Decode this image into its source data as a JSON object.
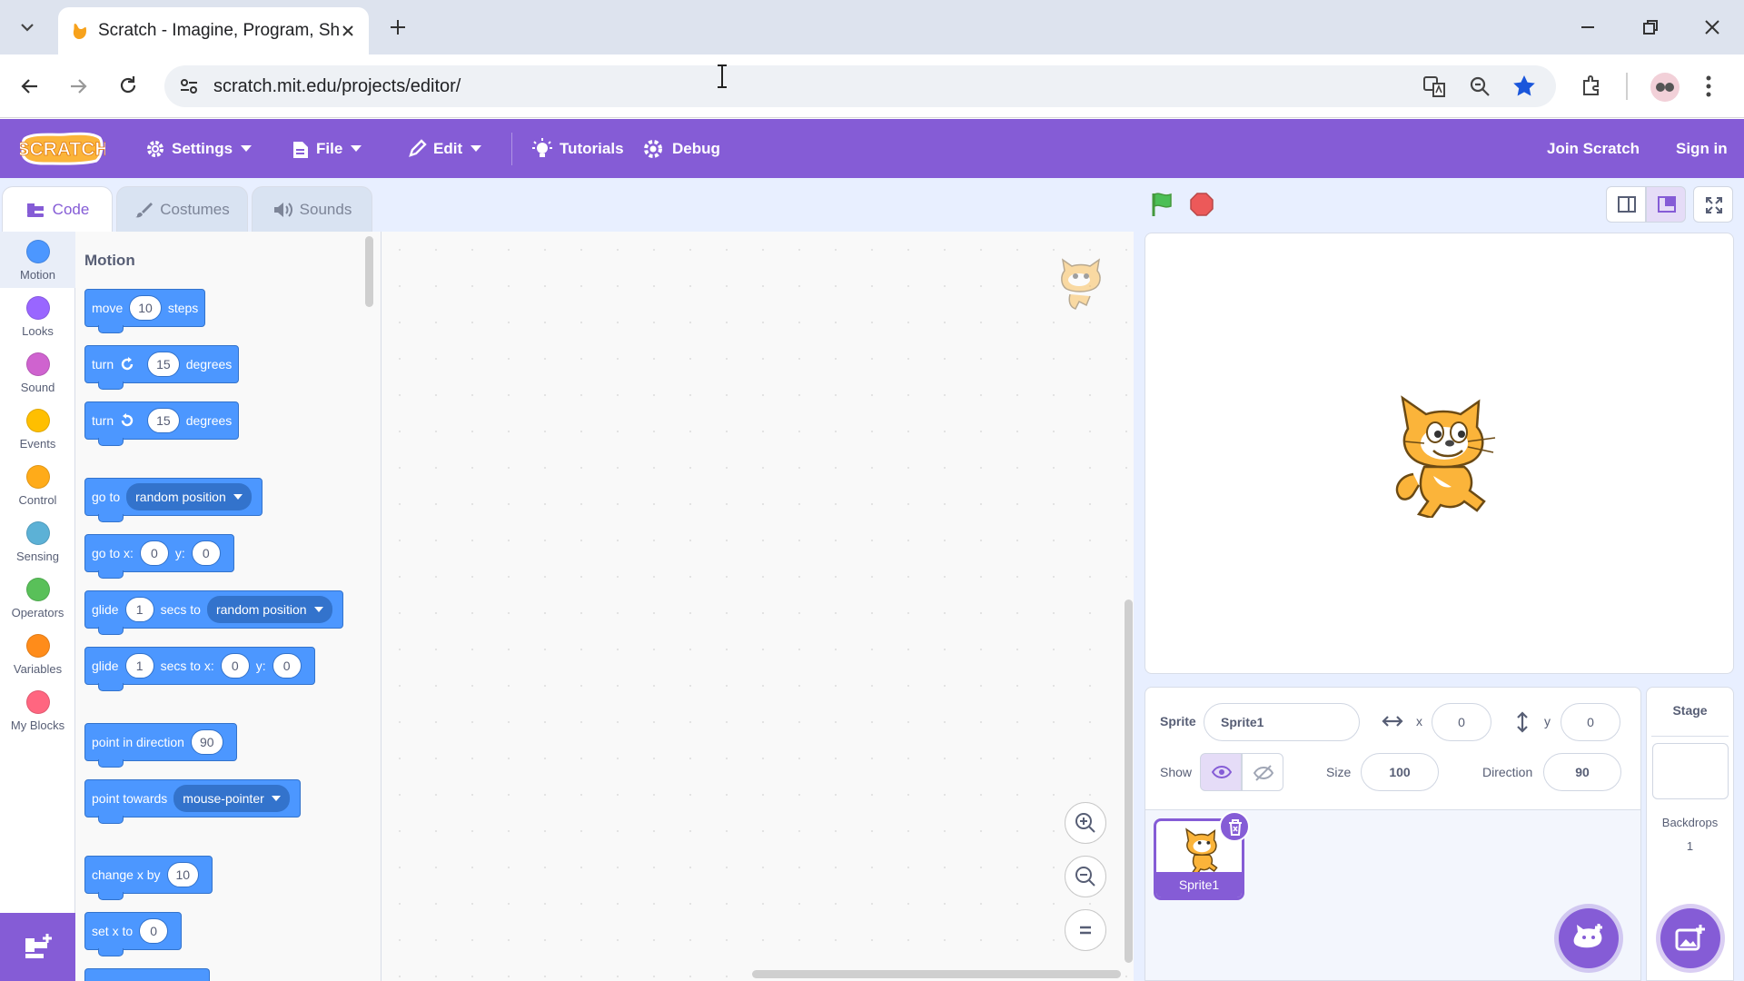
{
  "browser": {
    "tab_title": "Scratch - Imagine, Program, Share",
    "url": "scratch.mit.edu/projects/editor/"
  },
  "menu": {
    "settings": "Settings",
    "file": "File",
    "edit": "Edit",
    "tutorials": "Tutorials",
    "debug": "Debug",
    "join": "Join Scratch",
    "signin": "Sign in"
  },
  "editor_tabs": {
    "code": "Code",
    "costumes": "Costumes",
    "sounds": "Sounds"
  },
  "categories": [
    {
      "label": "Motion",
      "color": "#4c97ff"
    },
    {
      "label": "Looks",
      "color": "#9966ff"
    },
    {
      "label": "Sound",
      "color": "#cf63cf"
    },
    {
      "label": "Events",
      "color": "#ffbf00"
    },
    {
      "label": "Control",
      "color": "#ffab19"
    },
    {
      "label": "Sensing",
      "color": "#5cb1d6"
    },
    {
      "label": "Operators",
      "color": "#59c059"
    },
    {
      "label": "Variables",
      "color": "#ff8c1a"
    },
    {
      "label": "My Blocks",
      "color": "#ff6680"
    }
  ],
  "palette": {
    "heading": "Motion",
    "move": {
      "a": "move",
      "v": "10",
      "b": "steps"
    },
    "turn_right": {
      "a": "turn",
      "v": "15",
      "b": "degrees"
    },
    "turn_left": {
      "a": "turn",
      "v": "15",
      "b": "degrees"
    },
    "goto": {
      "a": "go to",
      "dd": "random position"
    },
    "gotoxy": {
      "a": "go to x:",
      "x": "0",
      "b": "y:",
      "y": "0"
    },
    "glide_to": {
      "a": "glide",
      "v": "1",
      "b": "secs to",
      "dd": "random position"
    },
    "glide_xy": {
      "a": "glide",
      "v": "1",
      "b": "secs to x:",
      "x": "0",
      "c": "y:",
      "y": "0"
    },
    "point_dir": {
      "a": "point in direction",
      "v": "90"
    },
    "point_towards": {
      "a": "point towards",
      "dd": "mouse-pointer"
    },
    "change_x": {
      "a": "change x by",
      "v": "10"
    },
    "set_x": {
      "a": "set x to",
      "v": "0"
    }
  },
  "sprite_info": {
    "sprite_label": "Sprite",
    "sprite_name": "Sprite1",
    "x_label": "x",
    "x": "0",
    "y_label": "y",
    "y": "0",
    "show_label": "Show",
    "size_label": "Size",
    "size": "100",
    "direction_label": "Direction",
    "direction": "90"
  },
  "sprites": [
    {
      "name": "Sprite1"
    }
  ],
  "stage_panel": {
    "title": "Stage",
    "backdrops_label": "Backdrops",
    "backdrops_count": "1"
  },
  "colors": {
    "accent": "#855cd6",
    "motion": "#4c97ff",
    "motion_dark": "#3373cc"
  }
}
